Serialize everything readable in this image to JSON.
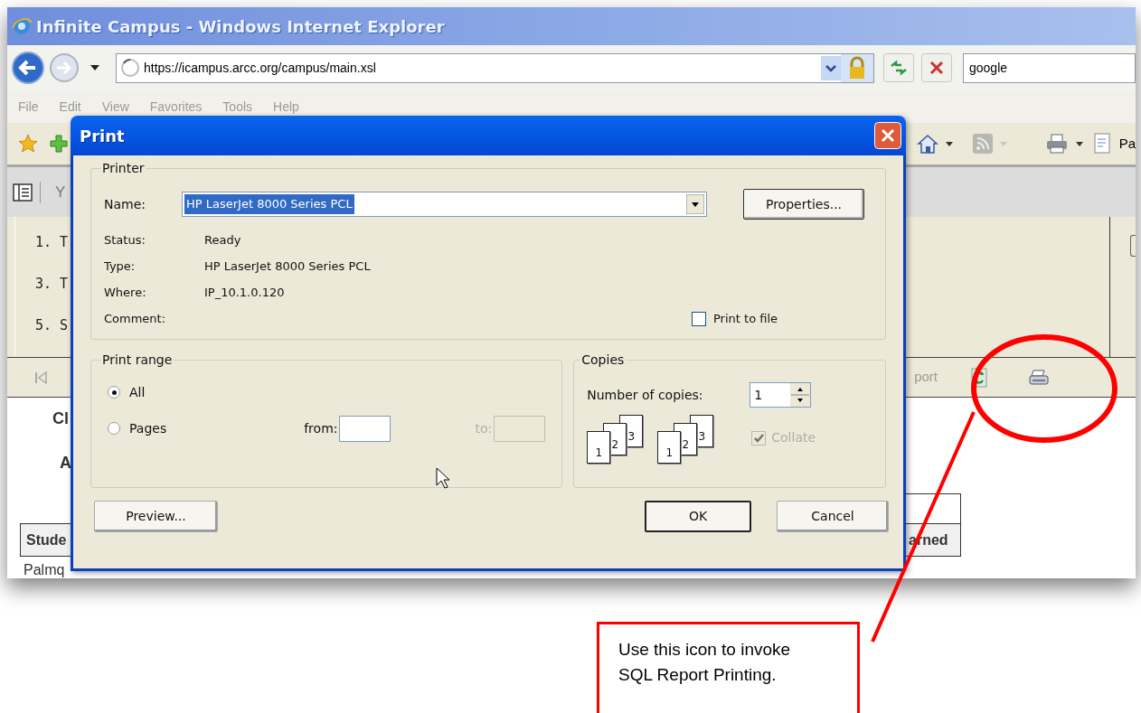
{
  "window": {
    "title": "Infinite Campus - Windows Internet Explorer"
  },
  "address_bar": {
    "url": "https://icampus.arcc.org/campus/main.xsl"
  },
  "search_box": {
    "value": "google"
  },
  "menu": [
    "File",
    "Edit",
    "View",
    "Favorites",
    "Tools",
    "Help"
  ],
  "command_bar": {
    "page_label": "Pa"
  },
  "page": {
    "tab_label": "Y",
    "items": [
      "1. T",
      "3. T",
      "5. S"
    ],
    "toolbar_text": "port",
    "heading": "Cl",
    "subheading": "A",
    "table_header_left": "Stude",
    "table_header_right": "arned",
    "row_text": "Palmq"
  },
  "dialog": {
    "title": "Print",
    "printer_group": "Printer",
    "name_label": "Name:",
    "name_value": "HP LaserJet 8000 Series PCL",
    "properties_button": "Properties...",
    "details": [
      {
        "label": "Status:",
        "value": "Ready"
      },
      {
        "label": "Type:",
        "value": "HP LaserJet 8000 Series PCL"
      },
      {
        "label": "Where:",
        "value": "IP_10.1.0.120"
      },
      {
        "label": "Comment:"
      }
    ],
    "print_to_file": {
      "label": "Print to file",
      "checked": false
    },
    "range_group": "Print range",
    "range_options": [
      {
        "label": "All",
        "selected": true
      },
      {
        "label": "Pages",
        "selected": false
      }
    ],
    "from_label": "from:",
    "to_label": "to:",
    "copies_group": "Copies",
    "copies_label": "Number of copies:",
    "copies_value": "1",
    "page_stacks": [
      [
        "1",
        "2",
        "3"
      ],
      [
        "1",
        "2",
        "3"
      ]
    ],
    "collate": {
      "label": "Collate",
      "checked": true,
      "disabled": true
    },
    "preview_button": "Preview...",
    "ok_button": "OK",
    "cancel_button": "Cancel"
  },
  "annotation": {
    "text": "Use this icon to invoke SQL Report Printing."
  }
}
